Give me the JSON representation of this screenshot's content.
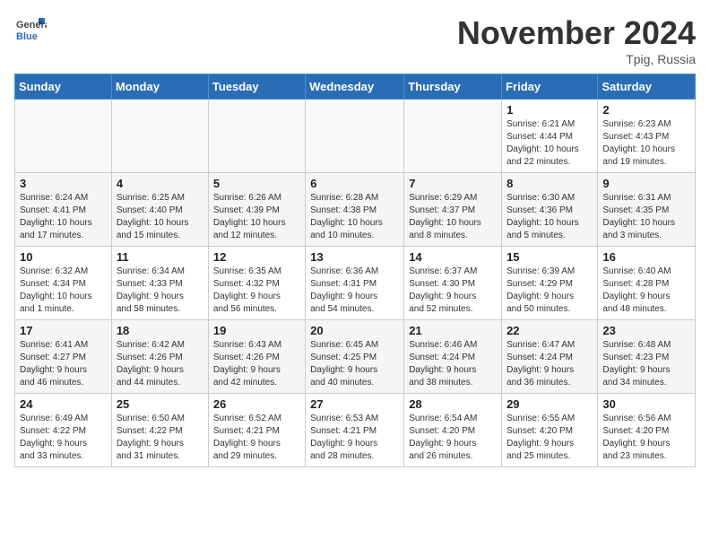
{
  "header": {
    "logo_line1": "General",
    "logo_line2": "Blue",
    "month": "November 2024",
    "location": "Tpig, Russia"
  },
  "weekdays": [
    "Sunday",
    "Monday",
    "Tuesday",
    "Wednesday",
    "Thursday",
    "Friday",
    "Saturday"
  ],
  "weeks": [
    [
      {
        "day": "",
        "info": ""
      },
      {
        "day": "",
        "info": ""
      },
      {
        "day": "",
        "info": ""
      },
      {
        "day": "",
        "info": ""
      },
      {
        "day": "",
        "info": ""
      },
      {
        "day": "1",
        "info": "Sunrise: 6:21 AM\nSunset: 4:44 PM\nDaylight: 10 hours\nand 22 minutes."
      },
      {
        "day": "2",
        "info": "Sunrise: 6:23 AM\nSunset: 4:43 PM\nDaylight: 10 hours\nand 19 minutes."
      }
    ],
    [
      {
        "day": "3",
        "info": "Sunrise: 6:24 AM\nSunset: 4:41 PM\nDaylight: 10 hours\nand 17 minutes."
      },
      {
        "day": "4",
        "info": "Sunrise: 6:25 AM\nSunset: 4:40 PM\nDaylight: 10 hours\nand 15 minutes."
      },
      {
        "day": "5",
        "info": "Sunrise: 6:26 AM\nSunset: 4:39 PM\nDaylight: 10 hours\nand 12 minutes."
      },
      {
        "day": "6",
        "info": "Sunrise: 6:28 AM\nSunset: 4:38 PM\nDaylight: 10 hours\nand 10 minutes."
      },
      {
        "day": "7",
        "info": "Sunrise: 6:29 AM\nSunset: 4:37 PM\nDaylight: 10 hours\nand 8 minutes."
      },
      {
        "day": "8",
        "info": "Sunrise: 6:30 AM\nSunset: 4:36 PM\nDaylight: 10 hours\nand 5 minutes."
      },
      {
        "day": "9",
        "info": "Sunrise: 6:31 AM\nSunset: 4:35 PM\nDaylight: 10 hours\nand 3 minutes."
      }
    ],
    [
      {
        "day": "10",
        "info": "Sunrise: 6:32 AM\nSunset: 4:34 PM\nDaylight: 10 hours\nand 1 minute."
      },
      {
        "day": "11",
        "info": "Sunrise: 6:34 AM\nSunset: 4:33 PM\nDaylight: 9 hours\nand 58 minutes."
      },
      {
        "day": "12",
        "info": "Sunrise: 6:35 AM\nSunset: 4:32 PM\nDaylight: 9 hours\nand 56 minutes."
      },
      {
        "day": "13",
        "info": "Sunrise: 6:36 AM\nSunset: 4:31 PM\nDaylight: 9 hours\nand 54 minutes."
      },
      {
        "day": "14",
        "info": "Sunrise: 6:37 AM\nSunset: 4:30 PM\nDaylight: 9 hours\nand 52 minutes."
      },
      {
        "day": "15",
        "info": "Sunrise: 6:39 AM\nSunset: 4:29 PM\nDaylight: 9 hours\nand 50 minutes."
      },
      {
        "day": "16",
        "info": "Sunrise: 6:40 AM\nSunset: 4:28 PM\nDaylight: 9 hours\nand 48 minutes."
      }
    ],
    [
      {
        "day": "17",
        "info": "Sunrise: 6:41 AM\nSunset: 4:27 PM\nDaylight: 9 hours\nand 46 minutes."
      },
      {
        "day": "18",
        "info": "Sunrise: 6:42 AM\nSunset: 4:26 PM\nDaylight: 9 hours\nand 44 minutes."
      },
      {
        "day": "19",
        "info": "Sunrise: 6:43 AM\nSunset: 4:26 PM\nDaylight: 9 hours\nand 42 minutes."
      },
      {
        "day": "20",
        "info": "Sunrise: 6:45 AM\nSunset: 4:25 PM\nDaylight: 9 hours\nand 40 minutes."
      },
      {
        "day": "21",
        "info": "Sunrise: 6:46 AM\nSunset: 4:24 PM\nDaylight: 9 hours\nand 38 minutes."
      },
      {
        "day": "22",
        "info": "Sunrise: 6:47 AM\nSunset: 4:24 PM\nDaylight: 9 hours\nand 36 minutes."
      },
      {
        "day": "23",
        "info": "Sunrise: 6:48 AM\nSunset: 4:23 PM\nDaylight: 9 hours\nand 34 minutes."
      }
    ],
    [
      {
        "day": "24",
        "info": "Sunrise: 6:49 AM\nSunset: 4:22 PM\nDaylight: 9 hours\nand 33 minutes."
      },
      {
        "day": "25",
        "info": "Sunrise: 6:50 AM\nSunset: 4:22 PM\nDaylight: 9 hours\nand 31 minutes."
      },
      {
        "day": "26",
        "info": "Sunrise: 6:52 AM\nSunset: 4:21 PM\nDaylight: 9 hours\nand 29 minutes."
      },
      {
        "day": "27",
        "info": "Sunrise: 6:53 AM\nSunset: 4:21 PM\nDaylight: 9 hours\nand 28 minutes."
      },
      {
        "day": "28",
        "info": "Sunrise: 6:54 AM\nSunset: 4:20 PM\nDaylight: 9 hours\nand 26 minutes."
      },
      {
        "day": "29",
        "info": "Sunrise: 6:55 AM\nSunset: 4:20 PM\nDaylight: 9 hours\nand 25 minutes."
      },
      {
        "day": "30",
        "info": "Sunrise: 6:56 AM\nSunset: 4:20 PM\nDaylight: 9 hours\nand 23 minutes."
      }
    ]
  ]
}
